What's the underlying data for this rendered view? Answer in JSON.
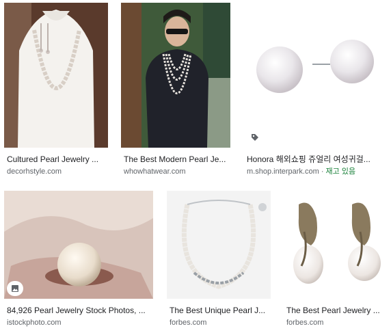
{
  "results": [
    {
      "title": "Cultured Pearl Jewelry ...",
      "source": "decorhstyle.com"
    },
    {
      "title": "The Best Modern Pearl Je...",
      "source": "whowhatwear.com"
    },
    {
      "title": "Honora 해외쇼핑 쥬얼리 여성귀걸...",
      "source": "m.shop.interpark.com",
      "stock": "재고 있음",
      "separator": " · "
    },
    {
      "title": "84,926 Pearl Jewelry Stock Photos, ...",
      "source": "istockphoto.com"
    },
    {
      "title": "The Best Unique Pearl J...",
      "source": "forbes.com"
    },
    {
      "title": "The Best Pearl Jewelry ...",
      "source": "forbes.com"
    }
  ],
  "icons": {
    "shopping": "tag-icon",
    "image": "image-icon"
  }
}
